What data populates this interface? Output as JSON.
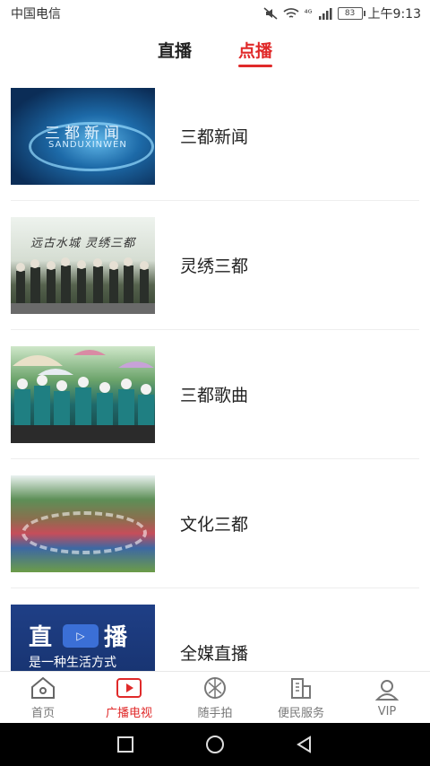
{
  "status_bar": {
    "carrier": "中国电信",
    "signal": "⁴ᴳ",
    "battery": "83",
    "time": "上午9:13"
  },
  "top_tabs": [
    {
      "label": "直播",
      "active": false
    },
    {
      "label": "点播",
      "active": true
    }
  ],
  "list": [
    {
      "title": "三都新闻",
      "thumb_text": "三都新闻",
      "thumb_sub": "SANDUXINWEN"
    },
    {
      "title": "灵绣三都",
      "thumb_text": "远古水城  灵绣三都"
    },
    {
      "title": "三都歌曲"
    },
    {
      "title": "文化三都"
    },
    {
      "title": "全媒直播",
      "thumb_text_a": "直",
      "thumb_text_b": "播",
      "thumb_slogan": "是一种生活方式"
    }
  ],
  "bottom_nav": [
    {
      "label": "首页",
      "icon": "home-icon",
      "active": false
    },
    {
      "label": "广播电视",
      "icon": "play-icon",
      "active": true
    },
    {
      "label": "随手拍",
      "icon": "aperture-icon",
      "active": false
    },
    {
      "label": "便民服务",
      "icon": "building-icon",
      "active": false
    },
    {
      "label": "VIP",
      "icon": "user-icon",
      "active": false
    }
  ],
  "colors": {
    "accent": "#e02a2a",
    "text": "#222222",
    "muted": "#777777"
  }
}
